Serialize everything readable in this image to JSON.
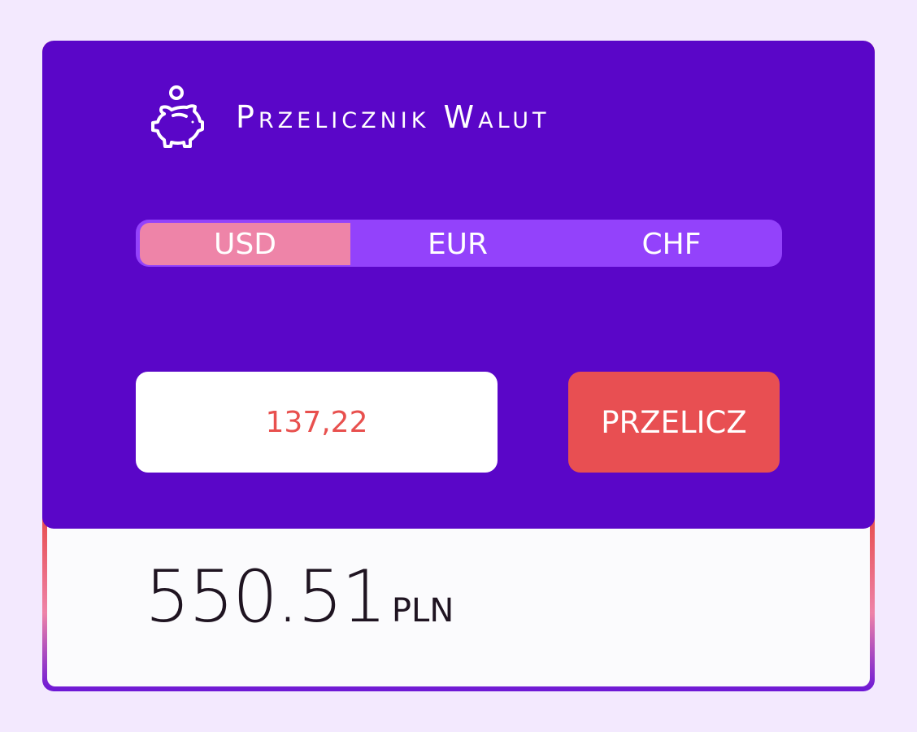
{
  "app": {
    "title": "Przelicznik Walut",
    "icon": "piggy-bank-icon"
  },
  "currency_tabs": [
    {
      "label": "USD",
      "active": true
    },
    {
      "label": "EUR",
      "active": false
    },
    {
      "label": "CHF",
      "active": false
    }
  ],
  "amount_input": {
    "value": "137,22"
  },
  "convert_button": {
    "label": "PRZELICZ"
  },
  "result": {
    "value": "550.51",
    "currency": "PLN"
  },
  "colors": {
    "page_background": "#f3e9fe",
    "panel": "#5a06c8",
    "tab_bar": "#9342fb",
    "tab_active": "#ee84a8",
    "accent_red": "#e84f52",
    "result_background": "#fbfbfd"
  }
}
